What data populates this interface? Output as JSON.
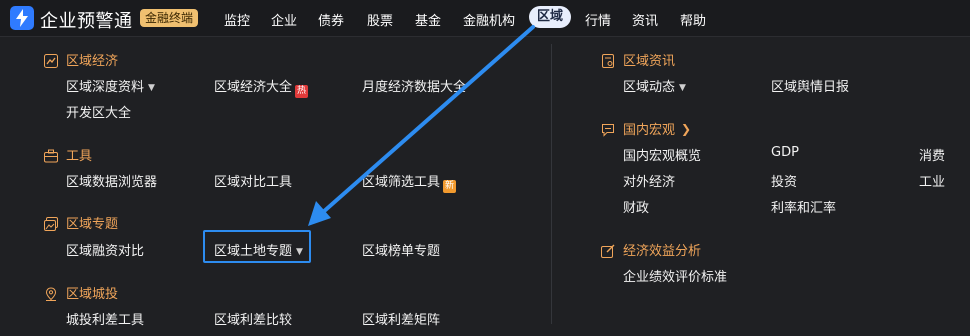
{
  "topbar": {
    "brand": "企业预警通",
    "badge": "金融终端",
    "nav": [
      "监控",
      "企业",
      "债券",
      "股票",
      "基金",
      "金融机构",
      "区域",
      "行情",
      "资讯",
      "帮助"
    ],
    "active_nav": "区域"
  },
  "sections": {
    "regional_economy": {
      "title": "区域经济",
      "items": [
        "区域深度资料",
        "区域经济大全",
        "月度经济数据大全",
        "开发区大全"
      ],
      "hot_tag": "热"
    },
    "tools": {
      "title": "工具",
      "items": [
        "区域数据浏览器",
        "区域对比工具",
        "区域筛选工具"
      ],
      "new_tag": "新"
    },
    "topics": {
      "title": "区域专题",
      "items": [
        "区域融资对比",
        "区域土地专题",
        "区域榜单专题"
      ]
    },
    "urban_investment": {
      "title": "区域城投",
      "items": [
        "城投利差工具",
        "区域利差比较",
        "区域利差矩阵"
      ]
    },
    "news": {
      "title": "区域资讯",
      "items": [
        "区域动态",
        "区域舆情日报"
      ]
    },
    "macro": {
      "title": "国内宏观",
      "items": [
        "国内宏观概览",
        "GDP",
        "消费",
        "对外经济",
        "投资",
        "工业",
        "财政",
        "利率和汇率"
      ]
    },
    "efficiency": {
      "title": "经济效益分析",
      "items": [
        "企业绩效评价标准"
      ]
    }
  },
  "colors": {
    "accent": "#f0a55a",
    "highlight": "#2d8cf0",
    "background": "#1f2023"
  }
}
